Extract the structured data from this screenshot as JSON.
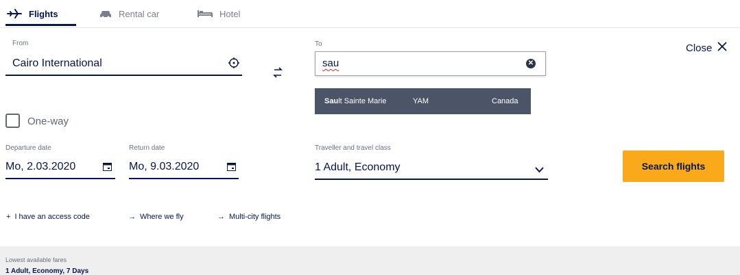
{
  "tabs": [
    {
      "label": "Flights",
      "icon": "plane-icon"
    },
    {
      "label": "Rental car",
      "icon": "car-icon"
    },
    {
      "label": "Hotel",
      "icon": "bed-icon"
    }
  ],
  "close": {
    "label": "Close"
  },
  "from": {
    "label": "From",
    "value": "Cairo International",
    "icon": "locate-icon"
  },
  "to": {
    "label": "To",
    "value": "sau",
    "icon": "clear-icon"
  },
  "swap_icon": "swap-icon",
  "suggestion": {
    "name_bold": "Sau",
    "name_rest": "lt Sainte Marie",
    "code": "YAM",
    "country": "Canada"
  },
  "one_way": {
    "label": "One-way",
    "checked": false
  },
  "departure": {
    "label": "Departure date",
    "value": "Mo, 2.03.2020",
    "icon": "calendar-icon"
  },
  "return": {
    "label": "Return date",
    "value": "Mo, 9.03.2020",
    "icon": "calendar-icon"
  },
  "traveller": {
    "label": "Traveller and travel class",
    "value": "1 Adult, Economy",
    "icon": "chevron-down-icon"
  },
  "search_button": {
    "label": "Search flights"
  },
  "links": [
    {
      "prefix": "+",
      "label": "I have an access code"
    },
    {
      "prefix": "→",
      "label": "Where we fly"
    },
    {
      "prefix": "→",
      "label": "Multi-city flights"
    }
  ],
  "fares": {
    "label": "Lowest available fares",
    "summary": "1 Adult, Economy, 7 Days"
  },
  "colors": {
    "navy": "#05164d",
    "accent": "#f9a91a",
    "suggestion_bg": "#4b5567"
  }
}
